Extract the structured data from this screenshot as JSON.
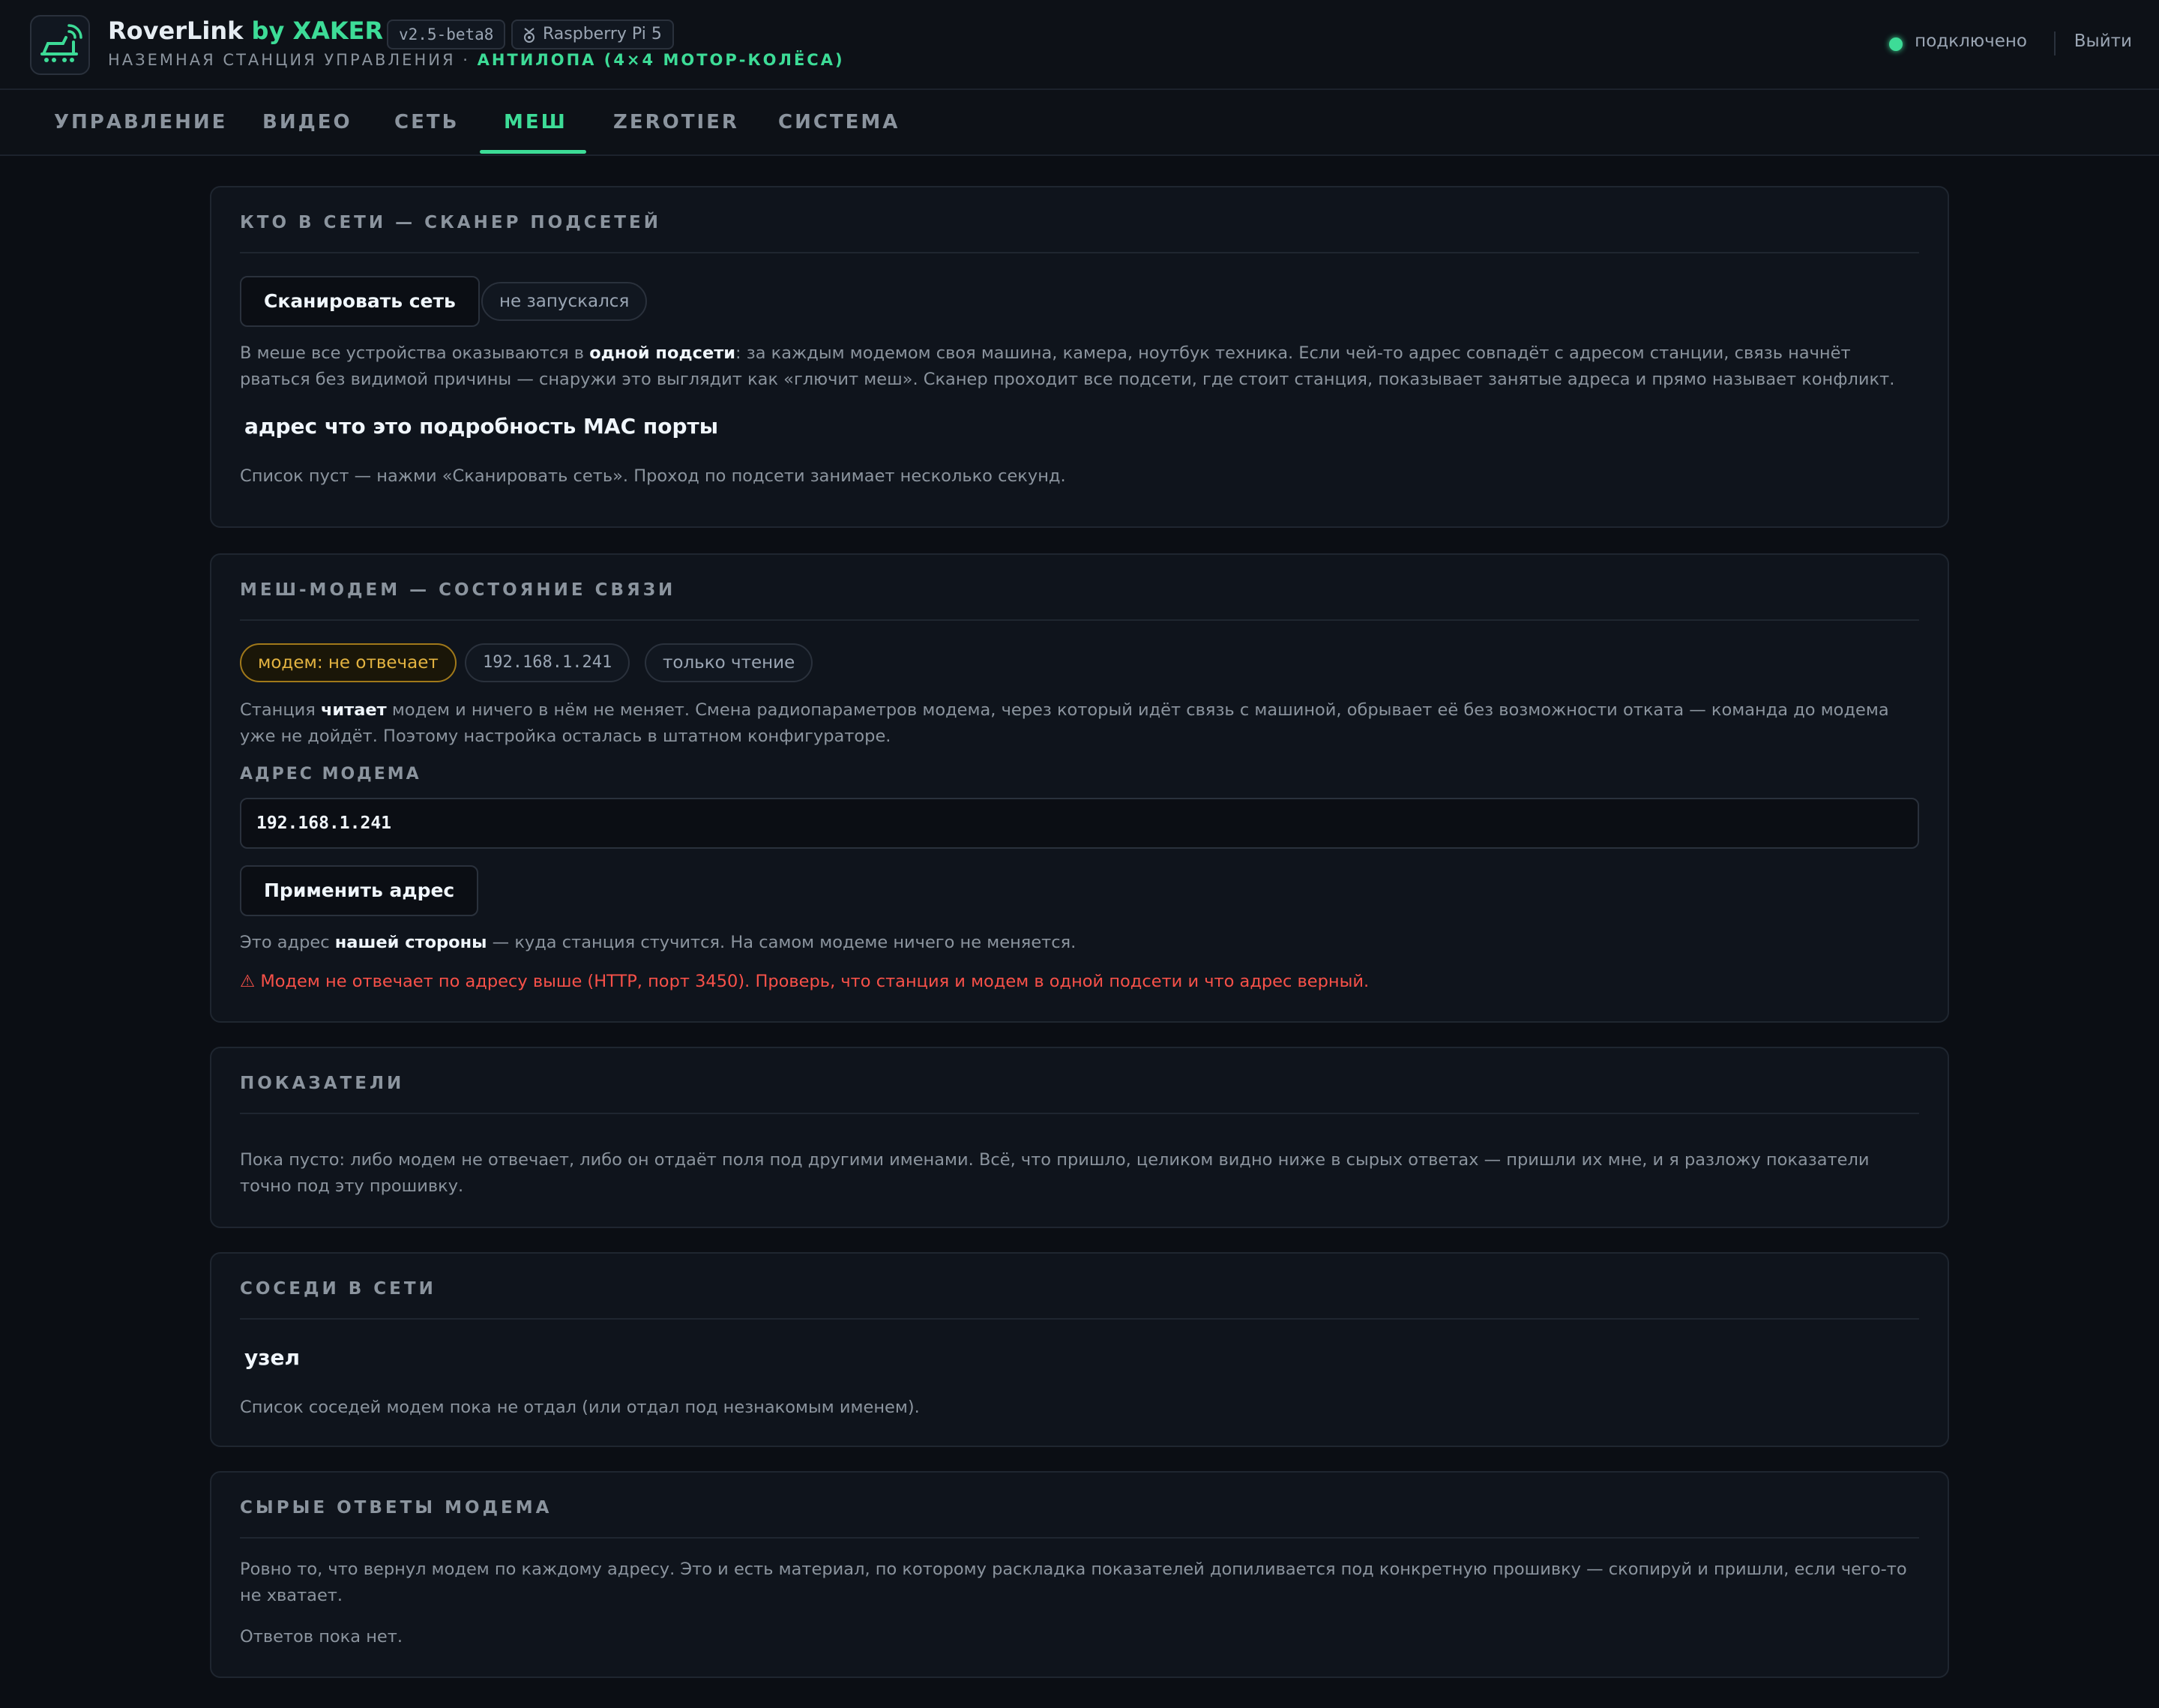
{
  "header": {
    "app_name": "RoverLink",
    "by": "by XAKER",
    "version": "v2.5-beta8",
    "hardware": "Raspberry Pi 5",
    "subtitle_prefix": "НАЗЕМНАЯ СТАНЦИЯ УПРАВЛЕНИЯ · ",
    "subtitle_accent": "АНТИЛОПА (4×4 МОТОР-КОЛЁСА)",
    "status": "подключено",
    "status_color": "#3ddc97",
    "logout": "Выйти"
  },
  "tabs": [
    {
      "label": "УПРАВЛЕНИЕ"
    },
    {
      "label": "ВИДЕО"
    },
    {
      "label": "СЕТЬ"
    },
    {
      "label": "МЕШ",
      "active": true
    },
    {
      "label": "ZEROTIER"
    },
    {
      "label": "СИСТЕМА"
    }
  ],
  "scanner": {
    "title": "КТО В СЕТИ — СКАНЕР ПОДСЕТЕЙ",
    "scan_button": "Сканировать сеть",
    "scan_status": "не запускался",
    "desc_1": "В меше все устройства оказываются в ",
    "desc_bold": "одной подсети",
    "desc_2": ": за каждым модемом своя машина, камера, ноутбук техника. Если чей-то адрес совпадёт с адресом станции, связь начнёт рваться без видимой причины — снаружи это выглядит как «глючит меш». Сканер проходит все подсети, где стоит станция, показывает занятые адреса и прямо называет конфликт.",
    "columns": [
      "адрес",
      "что это",
      "подробность",
      "MAC",
      "порты"
    ],
    "empty": "Список пуст — нажми «Сканировать сеть». Проход по подсети занимает несколько секунд."
  },
  "modem": {
    "title": "МЕШ-МОДЕМ — СОСТОЯНИЕ СВЯЗИ",
    "pill_status": "модем: не отвечает",
    "pill_ip": "192.168.1.241",
    "pill_mode": "только чтение",
    "desc_1": "Станция ",
    "desc_bold": "читает",
    "desc_2": " модем и ничего в нём не меняет. Смена радиопараметров модема, через который идёт связь с машиной, обрывает её без возможности отката — команда до модема уже не дойдёт. Поэтому настройка осталась в штатном конфигураторе.",
    "address_label": "АДРЕС МОДЕМА",
    "address_value": "192.168.1.241",
    "apply_button": "Применить адрес",
    "note_1": "Это адрес ",
    "note_bold": "нашей стороны",
    "note_2": " — куда станция стучится. На самом модеме ничего не меняется.",
    "error": "⚠ Модем не отвечает по адресу выше (HTTP, порт 3450). Проверь, что станция и модем в одной подсети и что адрес верный.",
    "error_color": "#f85149"
  },
  "metrics": {
    "title": "ПОКАЗАТЕЛИ",
    "text": "Пока пусто: либо модем не отвечает, либо он отдаёт поля под другими именами. Всё, что пришло, целиком видно ниже в сырых ответах — пришли их мне, и я разложу показатели точно под эту прошивку."
  },
  "neighbors": {
    "title": "СОСЕДИ В СЕТИ",
    "column": "узел",
    "empty": "Список соседей модем пока не отдал (или отдал под незнакомым именем)."
  },
  "raw": {
    "title": "СЫРЫЕ ОТВЕТЫ МОДЕМА",
    "text": "Ровно то, что вернул модем по каждому адресу. Это и есть материал, по которому раскладка показателей допиливается под конкретную прошивку — скопируй и пришли, если чего-то не хватает.",
    "empty": "Ответов пока нет."
  }
}
